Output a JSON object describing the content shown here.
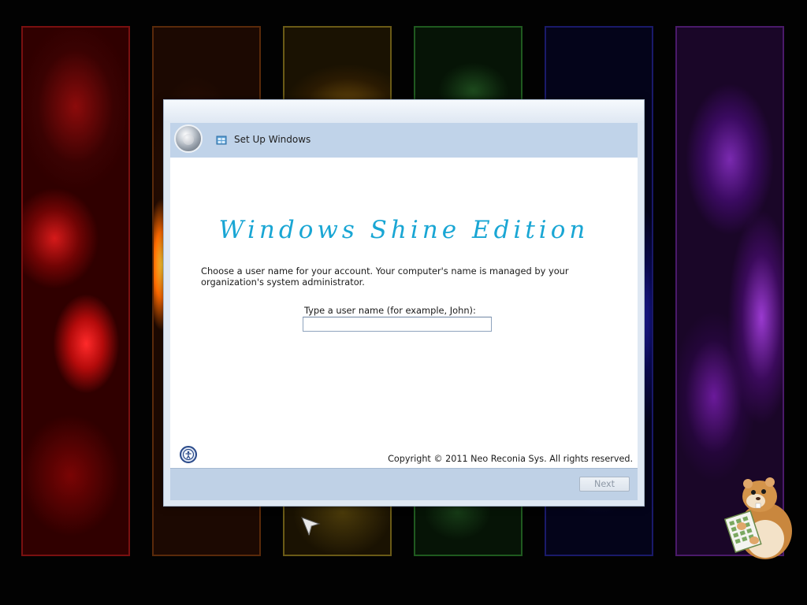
{
  "window": {
    "title": "Set Up Windows"
  },
  "branding": {
    "edition_title": "Windows Shine Edition",
    "color": "#19a6d4"
  },
  "content": {
    "instructions": "Choose a user name for your account.  Your computer's name is managed by your organization's system administrator.",
    "username_label": "Type a user name (for example, John):",
    "username_value": "",
    "username_placeholder": ""
  },
  "footer": {
    "copyright": "Copyright © 2011 Neo Reconia Sys.  All rights reserved.",
    "next_label": "Next",
    "next_enabled": false
  },
  "icons": {
    "back": "back-arrow-icon",
    "setup": "setup-windows-icon",
    "help": "ease-of-access-icon",
    "cursor": "mouse-pointer-icon",
    "mascot": "hamster-mascot-icon"
  },
  "background_panels": [
    {
      "name": "red",
      "color": "#b40b0b"
    },
    {
      "name": "orange",
      "color": "#ff6a00"
    },
    {
      "name": "yellow",
      "color": "#6a5a16"
    },
    {
      "name": "green",
      "color": "#1f5a1f"
    },
    {
      "name": "blue",
      "color": "#2a2ad0"
    },
    {
      "name": "purple",
      "color": "#7a2ab0"
    }
  ]
}
